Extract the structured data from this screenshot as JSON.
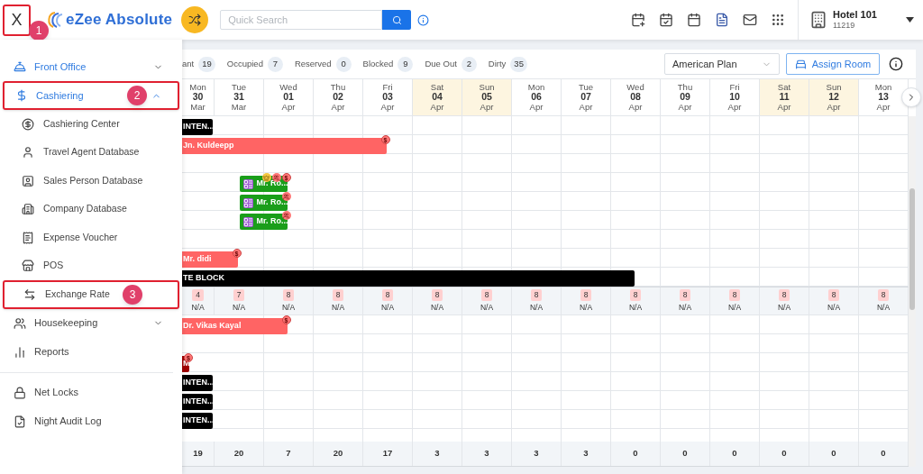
{
  "topbar": {
    "close_button": {
      "label": "X",
      "callout": "1"
    },
    "logo": "eZee Absolute",
    "search": {
      "placeholder": "Quick Search"
    },
    "hotel": {
      "name": "Hotel 101",
      "code": "11219"
    }
  },
  "sidebar": {
    "groups": [
      {
        "items": [
          {
            "label": "Front Office",
            "active": true,
            "expanded": false
          },
          {
            "label": "Cashiering",
            "active": true,
            "expanded": true,
            "callout": "2",
            "children": [
              {
                "label": "Cashiering Center"
              },
              {
                "label": "Travel Agent Database"
              },
              {
                "label": "Sales Person Database"
              },
              {
                "label": "Company Database"
              },
              {
                "label": "Expense Voucher"
              },
              {
                "label": "POS"
              },
              {
                "label": "Exchange Rate",
                "callout": "3"
              }
            ]
          },
          {
            "label": "Housekeeping",
            "active": false,
            "expanded": false
          },
          {
            "label": "Reports",
            "active": false
          }
        ]
      },
      {
        "items": [
          {
            "label": "Net Locks",
            "active": false
          },
          {
            "label": "Night Audit Log",
            "active": false
          }
        ]
      }
    ]
  },
  "stats": [
    {
      "label": "ant",
      "count": "19"
    },
    {
      "label": "Occupied",
      "count": "7"
    },
    {
      "label": "Reserved",
      "count": "0"
    },
    {
      "label": "Blocked",
      "count": "9"
    },
    {
      "label": "Due Out",
      "count": "2"
    },
    {
      "label": "Dirty",
      "count": "35"
    }
  ],
  "plan_select": {
    "value": "American Plan"
  },
  "assign_button": "Assign Room",
  "grid": {
    "days": [
      {
        "day": "Mon",
        "date": "30",
        "month": "Mar",
        "weekend": false
      },
      {
        "day": "Tue",
        "date": "31",
        "month": "Mar",
        "weekend": false
      },
      {
        "day": "Wed",
        "date": "01",
        "month": "Apr",
        "weekend": false
      },
      {
        "day": "Thu",
        "date": "02",
        "month": "Apr",
        "weekend": false
      },
      {
        "day": "Fri",
        "date": "03",
        "month": "Apr",
        "weekend": false
      },
      {
        "day": "Sat",
        "date": "04",
        "month": "Apr",
        "weekend": true
      },
      {
        "day": "Sun",
        "date": "05",
        "month": "Apr",
        "weekend": true
      },
      {
        "day": "Mon",
        "date": "06",
        "month": "Apr",
        "weekend": false
      },
      {
        "day": "Tue",
        "date": "07",
        "month": "Apr",
        "weekend": false
      },
      {
        "day": "Wed",
        "date": "08",
        "month": "Apr",
        "weekend": false
      },
      {
        "day": "Thu",
        "date": "09",
        "month": "Apr",
        "weekend": false
      },
      {
        "day": "Fri",
        "date": "10",
        "month": "Apr",
        "weekend": false
      },
      {
        "day": "Sat",
        "date": "11",
        "month": "Apr",
        "weekend": true
      },
      {
        "day": "Sun",
        "date": "12",
        "month": "Apr",
        "weekend": true
      },
      {
        "day": "Mon",
        "date": "13",
        "month": "Apr",
        "weekend": false
      }
    ],
    "rows_top": [
      {
        "bars": [
          {
            "label": "INTEN...",
            "color": "#000000",
            "cut_start": true
          }
        ]
      },
      {
        "bars": [
          {
            "label": "Jn. Kuldeepp",
            "color": "#ff6464",
            "cut_start": true,
            "badges": [
              {
                "kind": "text",
                "label": "$"
              }
            ]
          }
        ]
      },
      {
        "bars": [
          {
            "label": "Mr. Ro...",
            "color": "#1a9e1a",
            "cut_start": false,
            "room_icon": true,
            "badges": [
              {
                "kind": "crown"
              },
              {
                "kind": "guest"
              },
              {
                "kind": "text",
                "label": "$"
              }
            ]
          }
        ]
      },
      {
        "bars": [
          {
            "label": "Mr. Ro...",
            "color": "#1a9e1a",
            "cut_start": false,
            "room_icon": true,
            "badges": [
              {
                "kind": "guest"
              }
            ]
          }
        ]
      },
      {
        "bars": [
          {
            "label": "Mr. Ro...",
            "color": "#1a9e1a",
            "cut_start": false,
            "room_icon": true,
            "badges": [
              {
                "kind": "guest"
              }
            ]
          }
        ]
      },
      {
        "bars": [
          {
            "label": "Mr. didi",
            "color": "#ff6464",
            "cut_start": true,
            "badges": [
              {
                "kind": "text",
                "label": "$"
              }
            ]
          }
        ]
      },
      {
        "bars": [
          {
            "label": "TE BLOCK",
            "color": "#000000",
            "cut_start": true
          }
        ]
      }
    ],
    "availability": [
      {
        "count": "4",
        "status": "N/A"
      },
      {
        "count": "7",
        "status": "N/A"
      },
      {
        "count": "8",
        "status": "N/A"
      },
      {
        "count": "8",
        "status": "N/A"
      },
      {
        "count": "8",
        "status": "N/A"
      },
      {
        "count": "8",
        "status": "N/A"
      },
      {
        "count": "8",
        "status": "N/A"
      },
      {
        "count": "8",
        "status": "N/A"
      },
      {
        "count": "8",
        "status": "N/A"
      },
      {
        "count": "8",
        "status": "N/A"
      },
      {
        "count": "8",
        "status": "N/A"
      },
      {
        "count": "8",
        "status": "N/A"
      },
      {
        "count": "8",
        "status": "N/A"
      },
      {
        "count": "8",
        "status": "N/A"
      },
      {
        "count": "8",
        "status": "N/A"
      }
    ],
    "rows_bottom": [
      {
        "bars": [
          {
            "label": "Dr. Vikas Kayal",
            "color": "#ff6464",
            "cut_start": true,
            "badges": [
              {
                "kind": "text",
                "label": "$"
              }
            ]
          }
        ]
      },
      {
        "bars": [
          {
            "label": "M",
            "color": "#a00000",
            "cut_start": true,
            "badges": [
              {
                "kind": "text",
                "label": "$"
              }
            ]
          }
        ]
      },
      {
        "bars": [
          {
            "label": "INTEN...",
            "color": "#000000",
            "cut_start": true
          }
        ]
      },
      {
        "bars": [
          {
            "label": "INTEN...",
            "color": "#000000",
            "cut_start": true
          }
        ]
      },
      {
        "bars": [
          {
            "label": "INTEN...",
            "color": "#000000",
            "cut_start": true
          }
        ]
      }
    ],
    "totals": [
      "19",
      "20",
      "7",
      "20",
      "17",
      "3",
      "3",
      "3",
      "3",
      "0",
      "0",
      "0",
      "0",
      "0",
      "0"
    ]
  }
}
